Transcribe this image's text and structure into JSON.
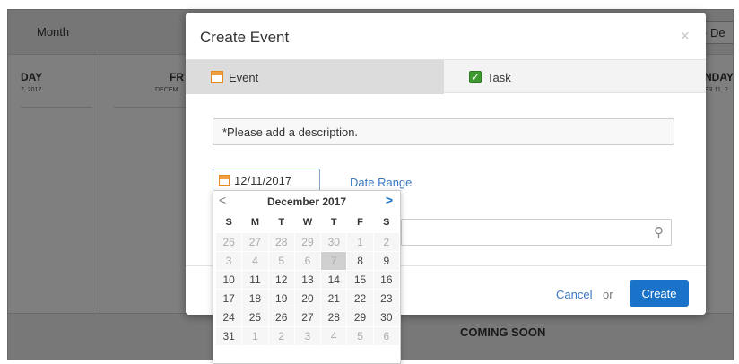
{
  "background": {
    "view_label": "Month",
    "range_label": "- De",
    "left_day": "DAY",
    "left_date": "7, 2017",
    "mid_day": "FR",
    "mid_date": "DECEM",
    "right_day": "NDAY",
    "right_date": "ER 11, 2",
    "coming_soon": "COMING SOON"
  },
  "modal": {
    "title": "Create Event",
    "close_icon": "×",
    "tabs": [
      {
        "label": "Event",
        "icon": "calendar-icon"
      },
      {
        "label": "Task",
        "icon": "checkbox-icon"
      }
    ],
    "description_value": "*Please add a description.",
    "date_value": "12/11/2017",
    "date_range_label": "Date Range",
    "cancel_label": "Cancel",
    "or_label": "or",
    "create_label": "Create"
  },
  "datepicker": {
    "prev": "<",
    "next": ">",
    "month_label": "December 2017",
    "weekdays": [
      "S",
      "M",
      "T",
      "W",
      "T",
      "F",
      "S"
    ],
    "weeks": [
      [
        "26",
        "27",
        "28",
        "29",
        "30",
        "1",
        "2"
      ],
      [
        "3",
        "4",
        "5",
        "6",
        "7",
        "8",
        "9"
      ],
      [
        "10",
        "11",
        "12",
        "13",
        "14",
        "15",
        "16"
      ],
      [
        "17",
        "18",
        "19",
        "20",
        "21",
        "22",
        "23"
      ],
      [
        "24",
        "25",
        "26",
        "27",
        "28",
        "29",
        "30"
      ],
      [
        "31",
        "1",
        "2",
        "3",
        "4",
        "5",
        "6"
      ]
    ],
    "today": "7"
  },
  "colors": {
    "accent": "#1a73c8",
    "link": "#3a78c2"
  }
}
